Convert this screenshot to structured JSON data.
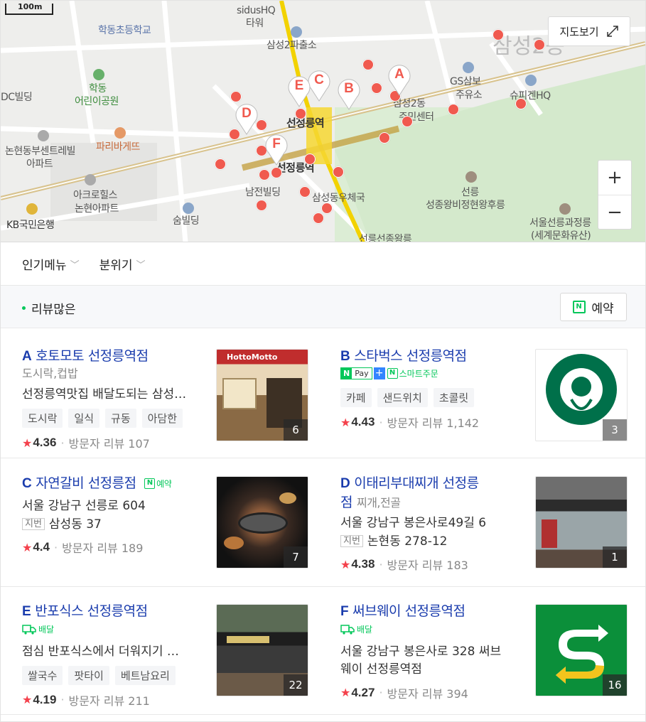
{
  "map": {
    "scale_label": "100m",
    "view_map_label": "지도보기",
    "zoom_in": "+",
    "zoom_out": "−",
    "labels": {
      "sidus": "sidusHQ",
      "tower": "타워",
      "hakdong_school": "학동초등학교",
      "samsung2_police": "삼성2파출소",
      "samsung2dong": "삼성2동",
      "dc_building": "DC빌딩",
      "hakdong": "학동",
      "children_park": "어린이공원",
      "gs_samsung": "GS삼보",
      "gas_station": "주유소",
      "supigen": "슈피겐HQ",
      "samsung2_center1": "삼성2동",
      "samsung2_center2": "주민센터",
      "paris": "파리바게뜨",
      "nonhyeon_center": "논현동부센트레빌",
      "apt": "아파트",
      "station_top": "선정릉역",
      "station_bottom": "선정릉역",
      "akro1": "아크로힐스",
      "akro2": "논현아파트",
      "namjeon": "남전빌딩",
      "post_office": "삼성동우체국",
      "seonneung": "선릉",
      "seongjong": "성종왕비정현왕후릉",
      "kb_bank": "KB국민은행",
      "sum": "숨빌딩",
      "seoul_seonneung1": "서울선릉과정릉",
      "seoul_seonneung2": "(세계문화유산)",
      "seonneung_bottom": "선릉선종왕릉"
    },
    "pins": [
      "A",
      "B",
      "C",
      "D",
      "E",
      "F"
    ]
  },
  "filters": {
    "popular_menu": "인기메뉴",
    "atmosphere": "분위기"
  },
  "sort": {
    "label": "리뷰많은",
    "reserve_label": "예약"
  },
  "places": [
    {
      "letter": "A",
      "name": "호토모토 선정릉역점",
      "category": "도시락,컵밥",
      "description": "선정릉역맛집 배달도되는 삼성…",
      "tags": [
        "도시락",
        "일식",
        "규동",
        "아담한"
      ],
      "rating": "4.36",
      "reviews": "방문자 리뷰 107",
      "photo_count": "6"
    },
    {
      "letter": "B",
      "name": "스타벅스 선정릉역점",
      "pay_label": "Pay",
      "smart_order": "스마트주문",
      "tags": [
        "카페",
        "샌드위치",
        "초콜릿"
      ],
      "rating": "4.43",
      "reviews": "방문자 리뷰 1,142",
      "photo_count": "3"
    },
    {
      "letter": "C",
      "name": "자연갈비 선정릉점",
      "reserve_badge": "예약",
      "address": "서울 강남구 선릉로 604",
      "jibun_label": "지번",
      "jibun": "삼성동 37",
      "rating": "4.4",
      "reviews": "방문자 리뷰 189",
      "photo_count": "7"
    },
    {
      "letter": "D",
      "name_line1": "이태리부대찌개 선정릉",
      "name_line2": "점",
      "category": "찌개,전골",
      "address": "서울 강남구 봉은사로49길 6",
      "jibun_label": "지번",
      "jibun": "논현동 278-12",
      "rating": "4.38",
      "reviews": "방문자 리뷰 183",
      "photo_count": "1"
    },
    {
      "letter": "E",
      "name": "반포식스 선정릉역점",
      "delivery_label": "배달",
      "description": "점심 반포식스에서 더워지기 …",
      "tags": [
        "쌀국수",
        "팟타이",
        "베트남요리"
      ],
      "rating": "4.19",
      "reviews": "방문자 리뷰 211",
      "photo_count": "22"
    },
    {
      "letter": "F",
      "name": "써브웨이 선정릉역점",
      "delivery_label": "배달",
      "address_line1": "서울 강남구 봉은사로 328 써브",
      "address_line2": "웨이 선정릉역점",
      "rating": "4.27",
      "reviews": "방문자 리뷰 394",
      "photo_count": "16"
    }
  ],
  "colors": {
    "title_blue": "#1a3cad",
    "naver_green": "#03c75a",
    "pin_red": "#f05a4f",
    "star_red": "#f4414c"
  }
}
